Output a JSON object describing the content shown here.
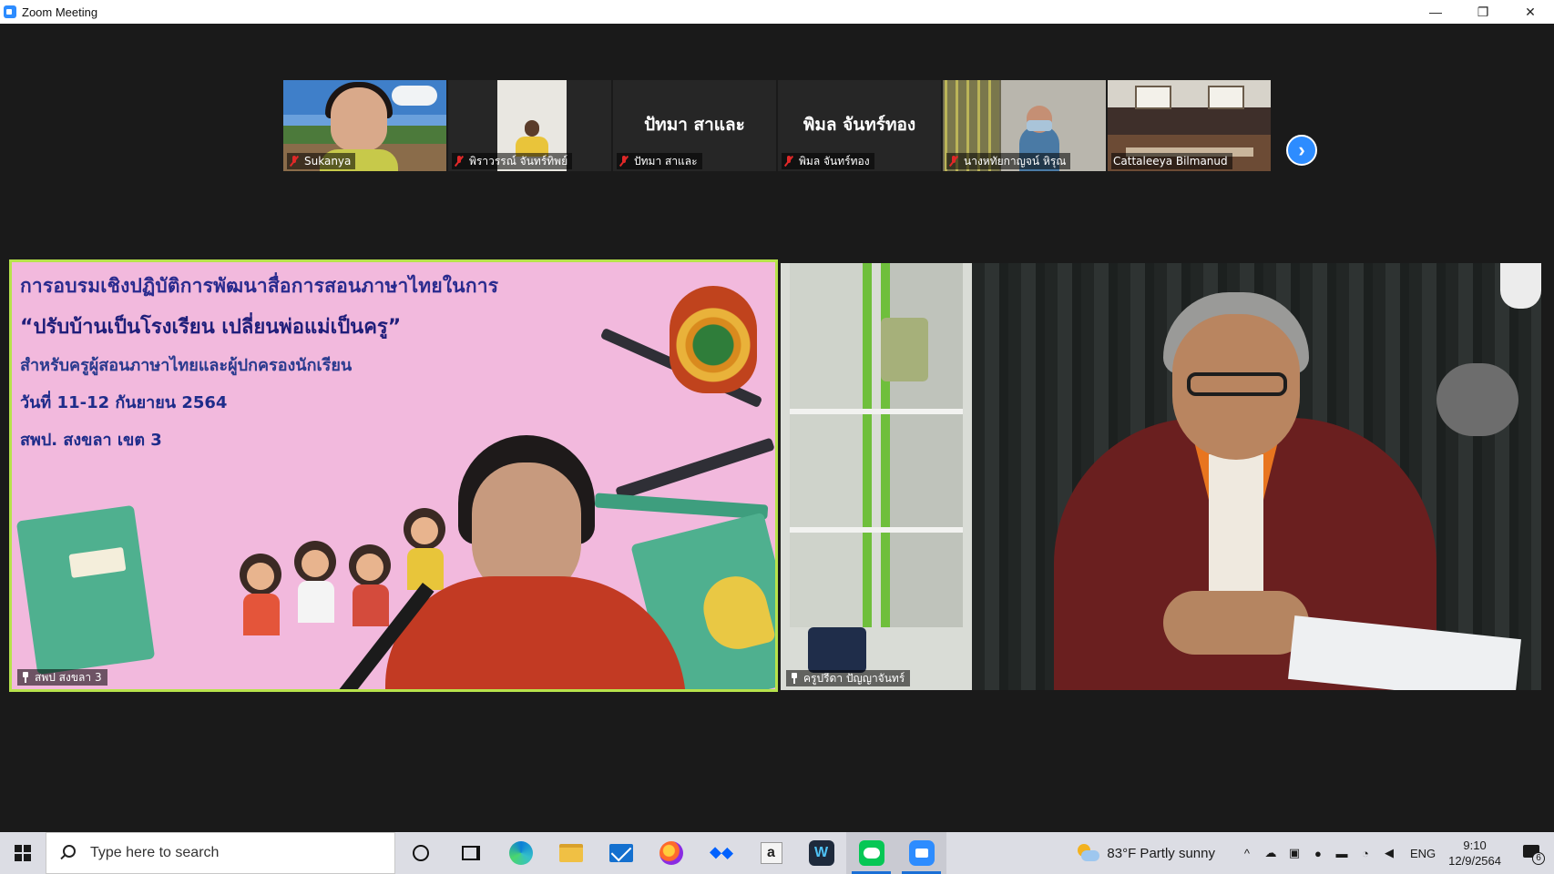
{
  "window": {
    "title": "Zoom Meeting",
    "minimize_glyph": "—",
    "restore_glyph": "❐",
    "close_glyph": "✕"
  },
  "thumbnails": [
    {
      "name": "Sukanya",
      "muted": true,
      "video": true
    },
    {
      "name": "พิราวรรณ์ จันทร์ทิพย์",
      "muted": true,
      "video": true
    },
    {
      "name": "ปัทมา สาและ",
      "display_name": "ปัทมา สาและ",
      "muted": true,
      "video": false
    },
    {
      "name": "พิมล จันทร์ทอง",
      "display_name": "พิมล จันทร์ทอง",
      "muted": true,
      "video": false
    },
    {
      "name": "นางหทัยกาญจน์ หิรุณ",
      "muted": true,
      "video": true
    },
    {
      "name": "Cattaleeya Bilmanud",
      "muted": false,
      "video": true
    }
  ],
  "strip_next_glyph": "›",
  "main_tiles": {
    "left": {
      "label": "สพป สงขลา 3",
      "pinned": true,
      "active_speaker": true,
      "slide": {
        "line1": "การอบรมเชิงปฏิบัติการพัฒนาสื่อการสอนภาษาไทยในการ",
        "line2": "“ปรับบ้านเป็นโรงเรียน เปลี่ยนพ่อแม่เป็นครู”",
        "line3": "สำหรับครูผู้สอนภาษาไทยและผู้ปกครองนักเรียน",
        "line4": "วันที่ 11-12 กันยายน 2564",
        "line5": "สพป. สงขลา เขต 3"
      }
    },
    "right": {
      "label": "ครูปรีดา ปัญญาจันทร์",
      "pinned": true
    }
  },
  "taskbar": {
    "search_placeholder": "Type here to search",
    "apps": [
      "cortana",
      "task-view",
      "edge",
      "file-explorer",
      "mail",
      "firefox",
      "dropbox",
      "amazon",
      "wacom",
      "line",
      "zoom"
    ],
    "amazon_glyph": "a",
    "wacom_glyph": "W",
    "weather": "83°F  Partly sunny",
    "chevron_glyph": "^",
    "language": "ENG",
    "time": "9:10",
    "date": "12/9/2564",
    "notification_count": "6"
  },
  "colors": {
    "zoom_blue": "#2d8cff",
    "active_speaker_border": "#b7e34b",
    "muted_red": "#e02828"
  }
}
